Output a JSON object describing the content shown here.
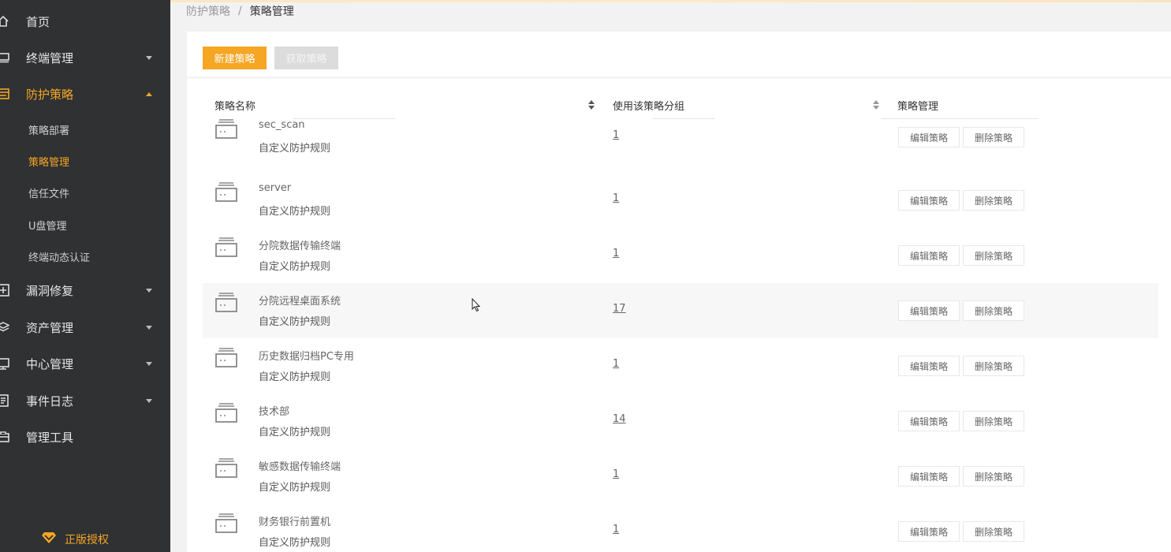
{
  "sidebar": {
    "items": [
      {
        "label": "首页",
        "icon": "home-icon"
      },
      {
        "label": "终端管理",
        "icon": "monitor-icon"
      },
      {
        "label": "防护策略",
        "icon": "policy-icon"
      },
      {
        "label": "漏洞修复",
        "icon": "patch-icon"
      },
      {
        "label": "资产管理",
        "icon": "layers-icon"
      },
      {
        "label": "中心管理",
        "icon": "center-icon"
      },
      {
        "label": "事件日志",
        "icon": "log-icon"
      },
      {
        "label": "管理工具",
        "icon": "tools-icon"
      }
    ],
    "sub_items": [
      {
        "label": "策略部署"
      },
      {
        "label": "策略管理"
      },
      {
        "label": "信任文件"
      },
      {
        "label": "U盘管理"
      },
      {
        "label": "终端动态认证"
      }
    ],
    "license_label": "正版授权"
  },
  "breadcrumb": {
    "parent": "防护策略",
    "separator": "/",
    "current": "策略管理"
  },
  "toolbar": {
    "new_label": "新建策略",
    "fetch_label": "获取策略"
  },
  "table": {
    "headers": {
      "name": "策略名称",
      "group": "使用该策略分组",
      "manage": "策略管理"
    },
    "edit_label": "编辑策略",
    "delete_label": "删除策略",
    "rows": [
      {
        "name": "sec_scan",
        "desc": "自定义防护规则",
        "count": "1"
      },
      {
        "name": "server",
        "desc": "自定义防护规则",
        "count": "1"
      },
      {
        "name": "分院数据传输终端",
        "desc": "自定义防护规则",
        "count": "1"
      },
      {
        "name": "分院远程桌面系统",
        "desc": "自定义防护规则",
        "count": "17"
      },
      {
        "name": "历史数据归档PC专用",
        "desc": "自定义防护规则",
        "count": "1"
      },
      {
        "name": "技术部",
        "desc": "自定义防护规则",
        "count": "14"
      },
      {
        "name": "敏感数据传输终端",
        "desc": "自定义防护规则",
        "count": "1"
      },
      {
        "name": "财务银行前置机",
        "desc": "自定义防护规则",
        "count": "1"
      }
    ]
  },
  "colors": {
    "accent": "#f5a623",
    "sidebar_bg": "#2f3133"
  }
}
